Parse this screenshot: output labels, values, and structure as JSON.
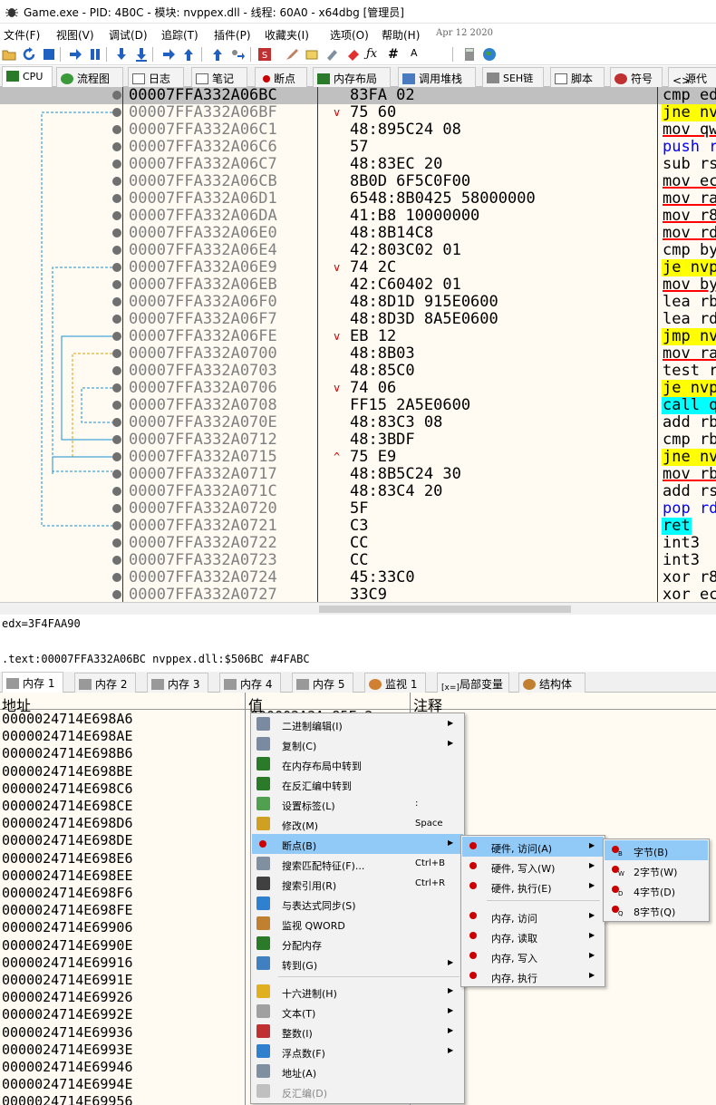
{
  "window": {
    "title": "Game.exe - PID: 4B0C - 模块: nvppex.dll - 线程: 60A0 - x64dbg [管理员]"
  },
  "menu": {
    "items": [
      "文件(F)",
      "视图(V)",
      "调试(D)",
      "追踪(T)",
      "插件(P)",
      "收藏夹(I)",
      "选项(O)",
      "帮助(H)"
    ],
    "date": "Apr 12 2020"
  },
  "toolbar": {
    "icons": [
      "open-icon",
      "restart-icon",
      "stop-icon",
      "run-icon",
      "pause-icon",
      "step-into-icon",
      "step-over-icon",
      "trace-into-icon",
      "trace-over-icon",
      "execute-till-return-icon",
      "run-to-user-code-icon",
      "script-icon",
      "comment-icon",
      "label-icon",
      "bookmark-icon",
      "function-icon",
      "fx-icon",
      "hash-icon",
      "font-icon",
      "help-icon",
      "calculator-icon",
      "globe-icon"
    ]
  },
  "tabs_top": [
    {
      "label": "CPU",
      "icon": "cpu-icon"
    },
    {
      "label": "流程图",
      "icon": "graph-icon"
    },
    {
      "label": "日志",
      "icon": "log-icon"
    },
    {
      "label": "笔记",
      "icon": "notes-icon"
    },
    {
      "label": "断点",
      "icon": "breakpoint-icon"
    },
    {
      "label": "内存布局",
      "icon": "memory-map-icon"
    },
    {
      "label": "调用堆栈",
      "icon": "call-stack-icon"
    },
    {
      "label": "SEH链",
      "icon": "seh-icon"
    },
    {
      "label": "脚本",
      "icon": "script-icon"
    },
    {
      "label": "符号",
      "icon": "symbols-icon"
    },
    {
      "label": "源代",
      "icon": "source-icon"
    }
  ],
  "disasm": {
    "rows": [
      {
        "addr": "00007FFA332A06BC",
        "arrow": "",
        "bytes": "83FA 02",
        "mn": "cmp ed",
        "hl": "none"
      },
      {
        "addr": "00007FFA332A06BF",
        "arrow": "v",
        "bytes": "75 60",
        "mn": "jne nv",
        "hl": "yellow"
      },
      {
        "addr": "00007FFA332A06C1",
        "arrow": "",
        "bytes": "48:895C24 08",
        "mn": "mov qw",
        "hl": "ul"
      },
      {
        "addr": "00007FFA332A06C6",
        "arrow": "",
        "bytes": "57",
        "mn": "push r",
        "hl": "blue"
      },
      {
        "addr": "00007FFA332A06C7",
        "arrow": "",
        "bytes": "48:83EC 20",
        "mn": "sub rs",
        "hl": "none"
      },
      {
        "addr": "00007FFA332A06CB",
        "arrow": "",
        "bytes": "8B0D 6F5C0F00",
        "mn": "mov ec",
        "hl": "ul"
      },
      {
        "addr": "00007FFA332A06D1",
        "arrow": "",
        "bytes": "6548:8B0425 58000000",
        "mn": "mov ra",
        "hl": "ul"
      },
      {
        "addr": "00007FFA332A06DA",
        "arrow": "",
        "bytes": "41:B8 10000000",
        "mn": "mov r8",
        "hl": "ul"
      },
      {
        "addr": "00007FFA332A06E0",
        "arrow": "",
        "bytes": "48:8B14C8",
        "mn": "mov rd",
        "hl": "ul"
      },
      {
        "addr": "00007FFA332A06E4",
        "arrow": "",
        "bytes": "42:803C02 01",
        "mn": "cmp by",
        "hl": "none"
      },
      {
        "addr": "00007FFA332A06E9",
        "arrow": "v",
        "bytes": "74 2C",
        "mn": "je nvp",
        "hl": "yellow"
      },
      {
        "addr": "00007FFA332A06EB",
        "arrow": "",
        "bytes": "42:C60402 01",
        "mn": "mov by",
        "hl": "ul"
      },
      {
        "addr": "00007FFA332A06F0",
        "arrow": "",
        "bytes": "48:8D1D 915E0600",
        "mn": "lea rb",
        "hl": "none"
      },
      {
        "addr": "00007FFA332A06F7",
        "arrow": "",
        "bytes": "48:8D3D 8A5E0600",
        "mn": "lea rd",
        "hl": "none"
      },
      {
        "addr": "00007FFA332A06FE",
        "arrow": "v",
        "bytes": "EB 12",
        "mn": "jmp nv",
        "hl": "yellow"
      },
      {
        "addr": "00007FFA332A0700",
        "arrow": "",
        "bytes": "48:8B03",
        "mn": "mov ra",
        "hl": "ul"
      },
      {
        "addr": "00007FFA332A0703",
        "arrow": "",
        "bytes": "48:85C0",
        "mn": "test r",
        "hl": "none"
      },
      {
        "addr": "00007FFA332A0706",
        "arrow": "v",
        "bytes": "74 06",
        "mn": "je nvp",
        "hl": "yellow"
      },
      {
        "addr": "00007FFA332A0708",
        "arrow": "",
        "bytes": "FF15 2A5E0600",
        "mn": "call q",
        "hl": "cyan"
      },
      {
        "addr": "00007FFA332A070E",
        "arrow": "",
        "bytes": "48:83C3 08",
        "mn": "add rb",
        "hl": "none"
      },
      {
        "addr": "00007FFA332A0712",
        "arrow": "",
        "bytes": "48:3BDF",
        "mn": "cmp rb",
        "hl": "none"
      },
      {
        "addr": "00007FFA332A0715",
        "arrow": "^",
        "bytes": "75 E9",
        "mn": "jne nv",
        "hl": "yellow"
      },
      {
        "addr": "00007FFA332A0717",
        "arrow": "",
        "bytes": "48:8B5C24 30",
        "mn": "mov rb",
        "hl": "ul"
      },
      {
        "addr": "00007FFA332A071C",
        "arrow": "",
        "bytes": "48:83C4 20",
        "mn": "add rs",
        "hl": "none"
      },
      {
        "addr": "00007FFA332A0720",
        "arrow": "",
        "bytes": "5F",
        "mn": "pop rd",
        "hl": "blue"
      },
      {
        "addr": "00007FFA332A0721",
        "arrow": "",
        "bytes": "C3",
        "mn": "ret",
        "hl": "cyan"
      },
      {
        "addr": "00007FFA332A0722",
        "arrow": "",
        "bytes": "CC",
        "mn": "int3",
        "hl": "none"
      },
      {
        "addr": "00007FFA332A0723",
        "arrow": "",
        "bytes": "CC",
        "mn": "int3",
        "hl": "none"
      },
      {
        "addr": "00007FFA332A0724",
        "arrow": "",
        "bytes": "45:33C0",
        "mn": "xor r8",
        "hl": "none"
      },
      {
        "addr": "00007FFA332A0727",
        "arrow": "",
        "bytes": "33C9",
        "mn": "xor ec",
        "hl": "none"
      }
    ]
  },
  "info": {
    "register_line": "edx=3F4FAA90",
    "location_line": ".text:00007FFA332A06BC nvppex.dll:$506BC #4FABC"
  },
  "tabs_bottom": [
    {
      "label": "内存 1",
      "icon": "memory-icon"
    },
    {
      "label": "内存 2",
      "icon": "memory-icon"
    },
    {
      "label": "内存 3",
      "icon": "memory-icon"
    },
    {
      "label": "内存 4",
      "icon": "memory-icon"
    },
    {
      "label": "内存 5",
      "icon": "memory-icon"
    },
    {
      "label": "监视 1",
      "icon": "watch-icon"
    },
    {
      "label": "局部变量",
      "icon": "locals-icon"
    },
    {
      "label": "结构体",
      "icon": "struct-icon"
    }
  ],
  "dump": {
    "headers": {
      "address": "地址",
      "value": "值",
      "comment": "注释"
    },
    "value_partial": "000002A2A-85Fa2",
    "addresses": [
      "0000024714E698A6",
      "0000024714E698AE",
      "0000024714E698B6",
      "0000024714E698BE",
      "0000024714E698C6",
      "0000024714E698CE",
      "0000024714E698D6",
      "0000024714E698DE",
      "0000024714E698E6",
      "0000024714E698EE",
      "0000024714E698F6",
      "0000024714E698FE",
      "0000024714E69906",
      "0000024714E6990E",
      "0000024714E69916",
      "0000024714E6991E",
      "0000024714E69926",
      "0000024714E6992E",
      "0000024714E69936",
      "0000024714E6993E",
      "0000024714E69946",
      "0000024714E6994E",
      "0000024714E69956"
    ]
  },
  "context_menu": {
    "items": [
      {
        "label": "二进制编辑(I)",
        "shortcut": "",
        "submenu": true,
        "icon": "binary-icon",
        "hl": false,
        "dis": false
      },
      {
        "label": "复制(C)",
        "shortcut": "",
        "submenu": true,
        "icon": "copy-icon",
        "hl": false,
        "dis": false
      },
      {
        "label": "在内存布局中转到",
        "shortcut": "",
        "submenu": false,
        "icon": "memory-map-icon",
        "hl": false,
        "dis": false
      },
      {
        "label": "在反汇编中转到",
        "shortcut": "",
        "submenu": false,
        "icon": "disasm-icon",
        "hl": false,
        "dis": false
      },
      {
        "label": "设置标签(L)",
        "shortcut": ":",
        "submenu": false,
        "icon": "label-icon",
        "hl": false,
        "dis": false
      },
      {
        "label": "修改(M)",
        "shortcut": "Space",
        "submenu": false,
        "icon": "pencil-icon",
        "hl": false,
        "dis": false
      },
      {
        "label": "断点(B)",
        "shortcut": "",
        "submenu": true,
        "icon": "breakpoint-icon",
        "hl": true,
        "dis": false
      },
      {
        "label": "搜索匹配特征(F)...",
        "shortcut": "Ctrl+B",
        "submenu": false,
        "icon": "search-icon",
        "hl": false,
        "dis": false
      },
      {
        "label": "搜索引用(R)",
        "shortcut": "Ctrl+R",
        "submenu": false,
        "icon": "binoculars-icon",
        "hl": false,
        "dis": false
      },
      {
        "label": "与表达式同步(S)",
        "shortcut": "",
        "submenu": false,
        "icon": "sync-icon",
        "hl": false,
        "dis": false
      },
      {
        "label": "监视 QWORD",
        "shortcut": "",
        "submenu": false,
        "icon": "watch-icon",
        "hl": false,
        "dis": false
      },
      {
        "label": "分配内存",
        "shortcut": "",
        "submenu": false,
        "icon": "allocate-icon",
        "hl": false,
        "dis": false
      },
      {
        "label": "转到(G)",
        "shortcut": "",
        "submenu": true,
        "icon": "goto-icon",
        "hl": false,
        "dis": false
      },
      {
        "label": "十六进制(H)",
        "shortcut": "",
        "submenu": true,
        "icon": "hex-icon",
        "hl": false,
        "dis": false
      },
      {
        "label": "文本(T)",
        "shortcut": "",
        "submenu": true,
        "icon": "text-icon",
        "hl": false,
        "dis": false
      },
      {
        "label": "整数(I)",
        "shortcut": "",
        "submenu": true,
        "icon": "integer-icon",
        "hl": false,
        "dis": false
      },
      {
        "label": "浮点数(F)",
        "shortcut": "",
        "submenu": true,
        "icon": "float-icon",
        "hl": false,
        "dis": false
      },
      {
        "label": "地址(A)",
        "shortcut": "",
        "submenu": false,
        "icon": "address-icon",
        "hl": false,
        "dis": false
      },
      {
        "label": "反汇编(D)",
        "shortcut": "",
        "submenu": false,
        "icon": "disasm-icon",
        "hl": false,
        "dis": true
      }
    ]
  },
  "breakpoint_menu": {
    "items": [
      {
        "label": "硬件, 访问(A)",
        "hl": true
      },
      {
        "label": "硬件, 写入(W)",
        "hl": false
      },
      {
        "label": "硬件, 执行(E)",
        "hl": false
      },
      {
        "label": "内存, 访问",
        "hl": false
      },
      {
        "label": "内存, 读取",
        "hl": false
      },
      {
        "label": "内存, 写入",
        "hl": false
      },
      {
        "label": "内存, 执行",
        "hl": false
      }
    ]
  },
  "size_menu": {
    "items": [
      {
        "label": "字节(B)",
        "tag": "B",
        "hl": true
      },
      {
        "label": "2字节(W)",
        "tag": "W",
        "hl": false
      },
      {
        "label": "4字节(D)",
        "tag": "D",
        "hl": false
      },
      {
        "label": "8字节(Q)",
        "tag": "Q",
        "hl": false
      }
    ]
  },
  "colors": {
    "accent": "#91c9f7",
    "disasm_bg": "#fffbf2",
    "selected_row": "#c0c0c0",
    "jump_highlight": "#ffff00",
    "call_highlight": "#00ffff",
    "mnemonic_blue": "#0000ff",
    "underline_red": "#ff0000"
  }
}
